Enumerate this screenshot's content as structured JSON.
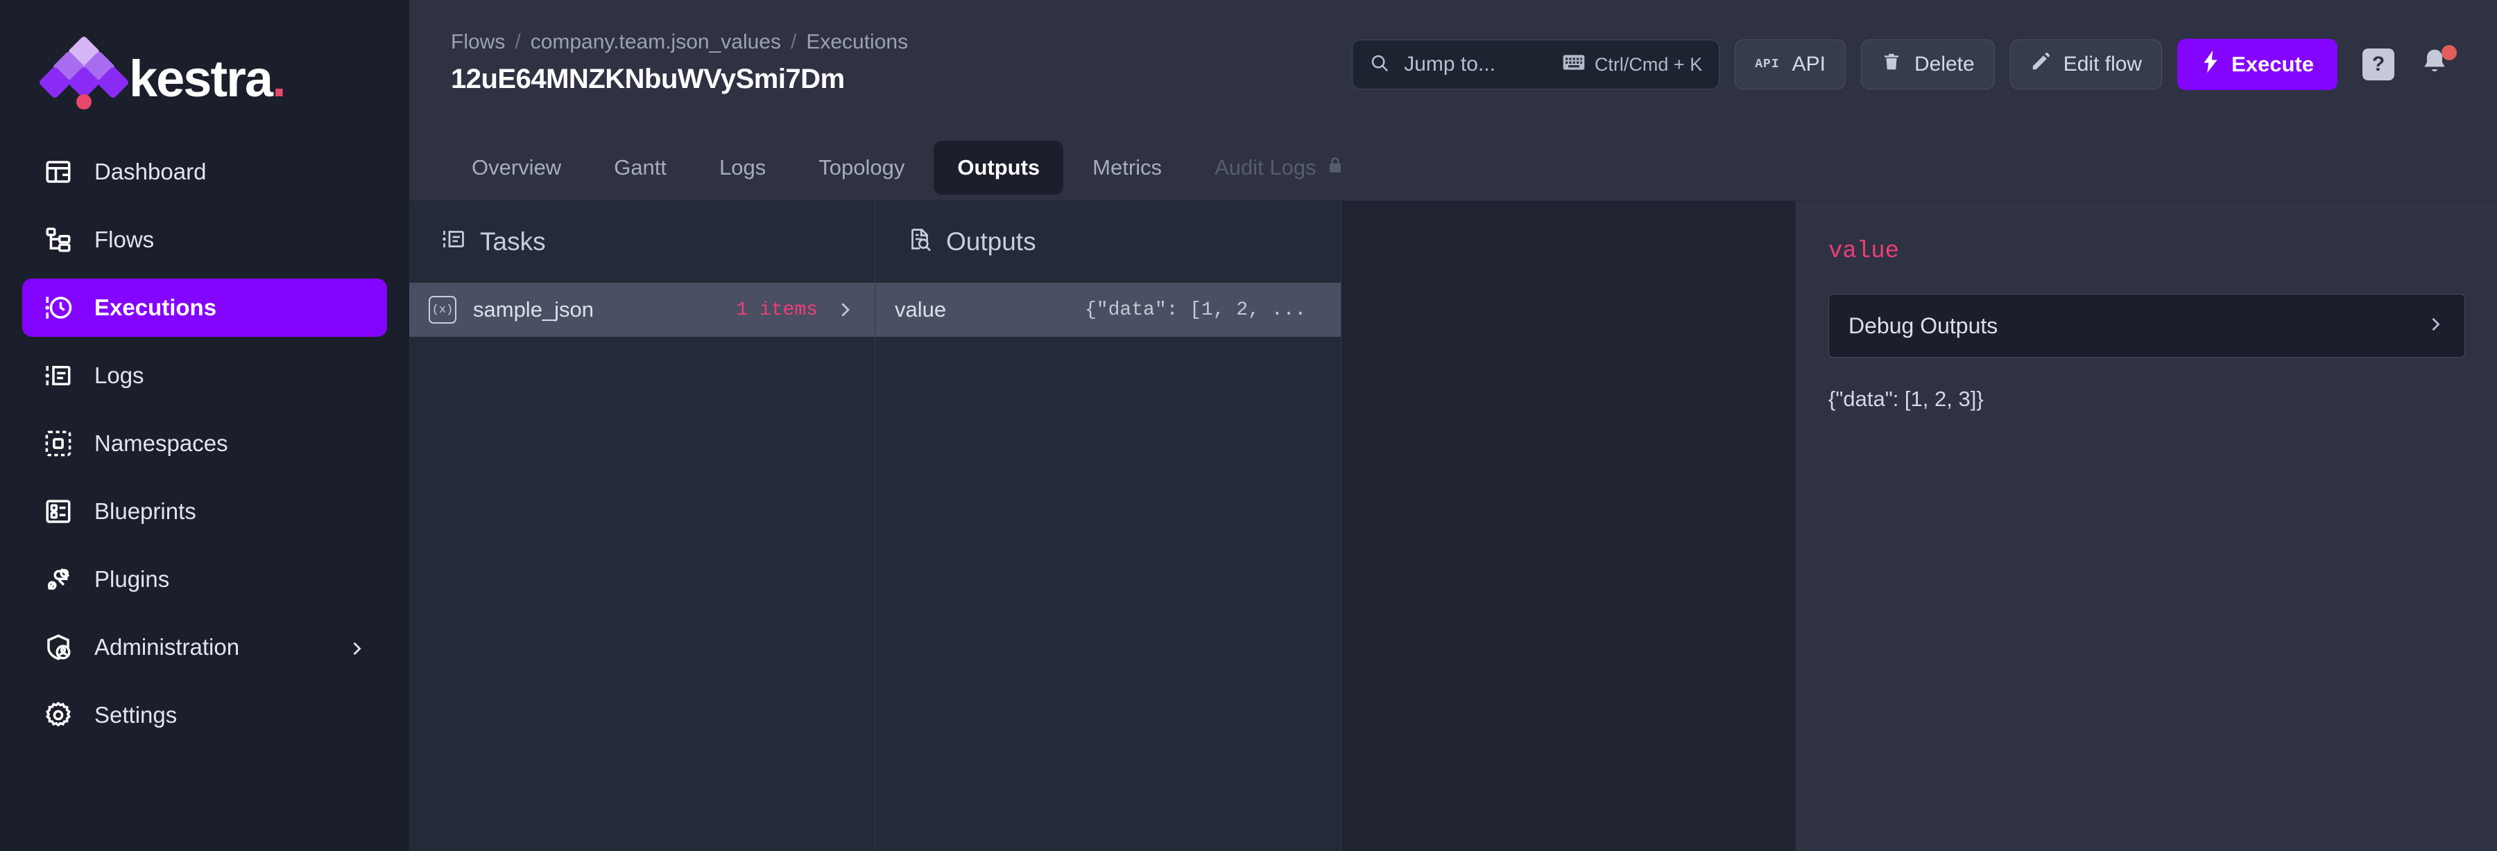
{
  "brand": {
    "name": "kestra",
    "dot": ".",
    "accent": "#8405FF",
    "pink": "#EE3D78"
  },
  "sidebar": {
    "items": [
      {
        "label": "Dashboard",
        "icon": "dashboard-icon",
        "active": false
      },
      {
        "label": "Flows",
        "icon": "flows-icon",
        "active": false
      },
      {
        "label": "Executions",
        "icon": "executions-icon",
        "active": true
      },
      {
        "label": "Logs",
        "icon": "logs-icon",
        "active": false
      },
      {
        "label": "Namespaces",
        "icon": "namespaces-icon",
        "active": false
      },
      {
        "label": "Blueprints",
        "icon": "blueprints-icon",
        "active": false
      },
      {
        "label": "Plugins",
        "icon": "plugins-icon",
        "active": false
      },
      {
        "label": "Administration",
        "icon": "administration-icon",
        "active": false,
        "expandable": true
      },
      {
        "label": "Settings",
        "icon": "settings-icon",
        "active": false
      }
    ]
  },
  "header": {
    "breadcrumb": [
      "Flows",
      "company.team.json_values",
      "Executions"
    ],
    "separator": "/",
    "title": "12uE64MNZKNbuWVySmi7Dm",
    "search": {
      "placeholder": "Jump to...",
      "shortcut": "Ctrl/Cmd + K"
    },
    "buttons": {
      "api": "API",
      "delete": "Delete",
      "edit_flow": "Edit flow",
      "execute": "Execute"
    },
    "help_label": "?",
    "notifications_badge": true
  },
  "tabs": [
    {
      "label": "Overview",
      "active": false,
      "locked": false
    },
    {
      "label": "Gantt",
      "active": false,
      "locked": false
    },
    {
      "label": "Logs",
      "active": false,
      "locked": false
    },
    {
      "label": "Topology",
      "active": false,
      "locked": false
    },
    {
      "label": "Outputs",
      "active": true,
      "locked": false
    },
    {
      "label": "Metrics",
      "active": false,
      "locked": false
    },
    {
      "label": "Audit Logs",
      "active": false,
      "locked": true
    }
  ],
  "tasks_panel": {
    "title": "Tasks",
    "rows": [
      {
        "name": "sample_json",
        "count": "1 items",
        "selected": true
      }
    ]
  },
  "outputs_panel": {
    "title": "Outputs",
    "rows": [
      {
        "key": "value",
        "preview": "{\"data\": [1, 2, ...",
        "selected": true
      }
    ]
  },
  "detail_panel": {
    "key": "value",
    "debug_label": "Debug Outputs",
    "value": "{\"data\": [1, 2, 3]}"
  }
}
